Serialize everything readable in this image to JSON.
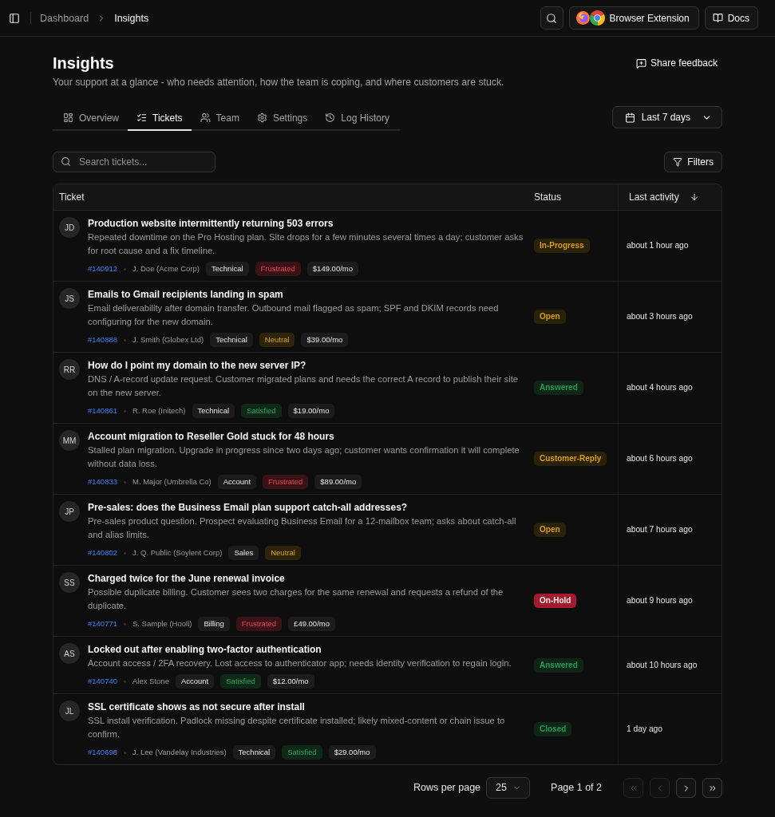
{
  "header": {
    "breadcrumb": [
      {
        "label": "Dashboard",
        "current": false
      },
      {
        "label": "Insights",
        "current": true
      }
    ],
    "extension_button": "Browser Extension",
    "docs_button": "Docs"
  },
  "page": {
    "title": "Insights",
    "subtitle": "Your support at a glance - who needs attention, how the team is coping, and where customers are stuck.",
    "share_button": "Share feedback"
  },
  "tabs": [
    {
      "label": "Overview",
      "selected": false
    },
    {
      "label": "Tickets",
      "selected": true
    },
    {
      "label": "Team",
      "selected": false
    },
    {
      "label": "Settings",
      "selected": false
    },
    {
      "label": "Log History",
      "selected": false
    }
  ],
  "date_range": "Last 7 days",
  "search": {
    "placeholder": "Search tickets..."
  },
  "filters_button": "Filters",
  "table": {
    "columns": [
      {
        "label": "Ticket"
      },
      {
        "label": "Status"
      },
      {
        "label": "Last activity",
        "sort_descending": true
      }
    ],
    "rows": [
      {
        "initials": "JD",
        "title": "Production website intermittently returning 503 errors",
        "description": "Repeated downtime on the Pro Hosting plan. Site drops for a few minutes several times a day; customer asks for root cause and a fix timeline.",
        "ticket_id": "#140912",
        "customer": "J. Doe (Acme Corp)",
        "category": "Technical",
        "sentiment": {
          "label": "Frustrated",
          "kind": "negative"
        },
        "price": "$149.00/mo",
        "status": {
          "label": "In-Progress",
          "kind": "pending"
        },
        "last_activity": "about 1 hour ago"
      },
      {
        "initials": "JS",
        "title": "Emails to Gmail recipients landing in spam",
        "description": "Email deliverability after domain transfer. Outbound mail flagged as spam; SPF and DKIM records need configuring for the new domain.",
        "ticket_id": "#140888",
        "customer": "J. Smith (Globex Ltd)",
        "category": "Technical",
        "sentiment": {
          "label": "Neutral",
          "kind": "neutral"
        },
        "price": "$39.00/mo",
        "status": {
          "label": "Open",
          "kind": "pending"
        },
        "last_activity": "about 3 hours ago"
      },
      {
        "initials": "RR",
        "title": "How do I point my domain to the new server IP?",
        "description": "DNS / A-record update request. Customer migrated plans and needs the correct A record to publish their site on the new server.",
        "ticket_id": "#140861",
        "customer": "R. Roe (Initech)",
        "category": "Technical",
        "sentiment": {
          "label": "Satisfied",
          "kind": "positive"
        },
        "price": "$19.00/mo",
        "status": {
          "label": "Answered",
          "kind": "resolved"
        },
        "last_activity": "about 4 hours ago"
      },
      {
        "initials": "MM",
        "title": "Account migration to Reseller Gold stuck for 48 hours",
        "description": "Stalled plan migration. Upgrade in progress since two days ago; customer wants confirmation it will complete without data loss.",
        "ticket_id": "#140833",
        "customer": "M. Major (Umbrella Co)",
        "category": "Account",
        "sentiment": {
          "label": "Frustrated",
          "kind": "negative"
        },
        "price": "$89.00/mo",
        "status": {
          "label": "Customer-Reply",
          "kind": "pending"
        },
        "last_activity": "about 6 hours ago"
      },
      {
        "initials": "JP",
        "title": "Pre-sales: does the Business Email plan support catch-all addresses?",
        "description": "Pre-sales product question. Prospect evaluating Business Email for a 12-mailbox team; asks about catch-all and alias limits.",
        "ticket_id": "#140802",
        "customer": "J. Q. Public (Soylent Corp)",
        "category": "Sales",
        "sentiment": {
          "label": "Neutral",
          "kind": "neutral"
        },
        "status": {
          "label": "Open",
          "kind": "pending"
        },
        "last_activity": "about 7 hours ago"
      },
      {
        "initials": "SS",
        "title": "Charged twice for the June renewal invoice",
        "description": "Possible duplicate billing. Customer sees two charges for the same renewal and requests a refund of the duplicate.",
        "ticket_id": "#140771",
        "customer": "S. Sample (Hooli)",
        "category": "Billing",
        "sentiment": {
          "label": "Frustrated",
          "kind": "negative"
        },
        "price": "£49.00/mo",
        "status": {
          "label": "On-Hold",
          "kind": "hold"
        },
        "last_activity": "about 9 hours ago"
      },
      {
        "initials": "AS",
        "title": "Locked out after enabling two-factor authentication",
        "description": "Account access / 2FA recovery. Lost access to authenticator app; needs identity verification to regain login.",
        "ticket_id": "#140740",
        "customer": "Alex Stone",
        "category": "Account",
        "sentiment": {
          "label": "Satisfied",
          "kind": "positive"
        },
        "price": "$12.00/mo",
        "status": {
          "label": "Answered",
          "kind": "resolved"
        },
        "last_activity": "about 10 hours ago"
      },
      {
        "initials": "JL",
        "title": "SSL certificate shows as not secure after install",
        "description": "SSL install verification. Padlock missing despite certificate installed; likely mixed-content or chain issue to confirm.",
        "ticket_id": "#140698",
        "customer": "J. Lee (Vandelay Industries)",
        "category": "Technical",
        "sentiment": {
          "label": "Satisfied",
          "kind": "positive"
        },
        "price": "$29.00/mo",
        "status": {
          "label": "Closed",
          "kind": "resolved"
        },
        "last_activity": "1 day ago"
      }
    ]
  },
  "pagination": {
    "rows_per_page_label": "Rows per page",
    "rows_per_page": "25",
    "page_label": "Page 1 of 2",
    "buttons": [
      {
        "kind": "first",
        "disabled": true
      },
      {
        "kind": "previous",
        "disabled": true
      },
      {
        "kind": "next",
        "disabled": false
      },
      {
        "kind": "last",
        "disabled": false
      }
    ]
  }
}
